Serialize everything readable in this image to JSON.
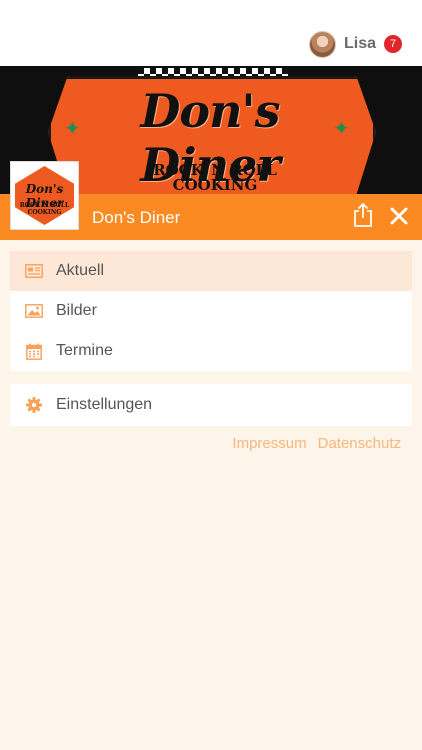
{
  "user": {
    "name": "Lisa",
    "notifications": "7"
  },
  "hero": {
    "sign_title": "Don's Diner",
    "sign_subtitle_1": "ROCK`N ROLL",
    "sign_subtitle_2": "COOKING",
    "logo_title": "Don's Diner",
    "logo_sub": "ROCK`N ROLL COOKING"
  },
  "header": {
    "title": "Don's Diner"
  },
  "menu": {
    "items": [
      {
        "label": "Aktuell",
        "icon": "newspaper-icon",
        "active": true
      },
      {
        "label": "Bilder",
        "icon": "image-icon",
        "active": false
      },
      {
        "label": "Termine",
        "icon": "calendar-icon",
        "active": false
      }
    ],
    "settings": {
      "label": "Einstellungen",
      "icon": "gear-icon"
    }
  },
  "footer": {
    "impressum": "Impressum",
    "datenschutz": "Datenschutz"
  },
  "colors": {
    "accent": "#fb8a22",
    "active_bg": "#fde7d6",
    "page_bg": "#fdf4ea",
    "badge": "#e0262c"
  }
}
